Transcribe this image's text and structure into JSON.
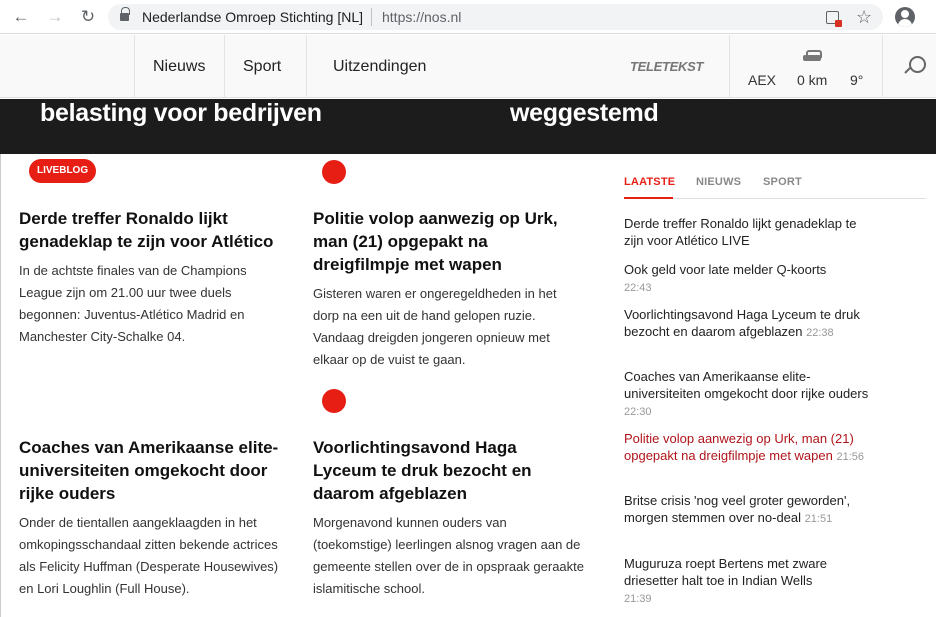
{
  "browser": {
    "site_name": "Nederlandse Omroep Stichting [NL]",
    "url": "https://nos.nl"
  },
  "header": {
    "nav": [
      "Nieuws",
      "Sport",
      "Uitzendingen"
    ],
    "teletekst": "TELETEKST",
    "aex": "AEX",
    "traffic": "0 km",
    "temperature": "9°"
  },
  "hero": {
    "left_title": "belasting voor bedrijven",
    "right_title": "weggestemd"
  },
  "badge": "LIVEBLOG",
  "articles": [
    {
      "title": "Derde treffer Ronaldo lijkt genadeklap te zijn voor Atlético",
      "text": "In de achtste finales van de Champions League zijn om 21.00 uur twee duels begonnen: Juventus-Atlético Madrid en Manchester City-Schalke 04."
    },
    {
      "title": "Politie volop aanwezig op Urk, man (21) opgepakt na dreigfilmpje met wapen",
      "text": "Gisteren waren er ongeregeldheden in het dorp na een uit de hand gelopen ruzie. Vandaag dreigden jongeren opnieuw met elkaar op de vuist te gaan."
    },
    {
      "title": "Coaches van Amerikaanse elite-universiteiten omgekocht door rijke ouders",
      "text": "Onder de tientallen aangeklaagden in het omkopingsschandaal zitten bekende actrices als Felicity Huffman (Desperate Housewives) en Lori Loughlin (Full House)."
    },
    {
      "title": "Voorlichtingsavond Haga Lyceum te druk bezocht en daarom afgeblazen",
      "text": "Morgenavond kunnen ouders van (toekomstige) leerlingen alsnog vragen aan de gemeente stellen over de in opspraak geraakte islamitische school."
    }
  ],
  "sidebar": {
    "tabs": [
      "LAATSTE",
      "NIEUWS",
      "SPORT"
    ],
    "items": [
      {
        "title": "Derde treffer Ronaldo lijkt genadeklap te zijn voor Atlético LIVE",
        "time": ""
      },
      {
        "title": "Ook geld voor late melder Q-koorts",
        "time": "22:43"
      },
      {
        "title": "Voorlichtingsavond Haga Lyceum te druk bezocht en daarom afgeblazen",
        "time": "22:38"
      },
      {
        "title": "Coaches van Amerikaanse elite-universiteiten omgekocht door rijke ouders",
        "time": "22:30"
      },
      {
        "title": "Politie volop aanwezig op Urk, man (21) opgepakt na dreigfilmpje met wapen",
        "time": "21:56"
      },
      {
        "title": "Britse crisis 'nog veel groter geworden', morgen stemmen over no-deal",
        "time": "21:51"
      },
      {
        "title": "Muguruza roept Bertens met zware driesetter halt toe in Indian Wells",
        "time": "21:39"
      }
    ]
  }
}
